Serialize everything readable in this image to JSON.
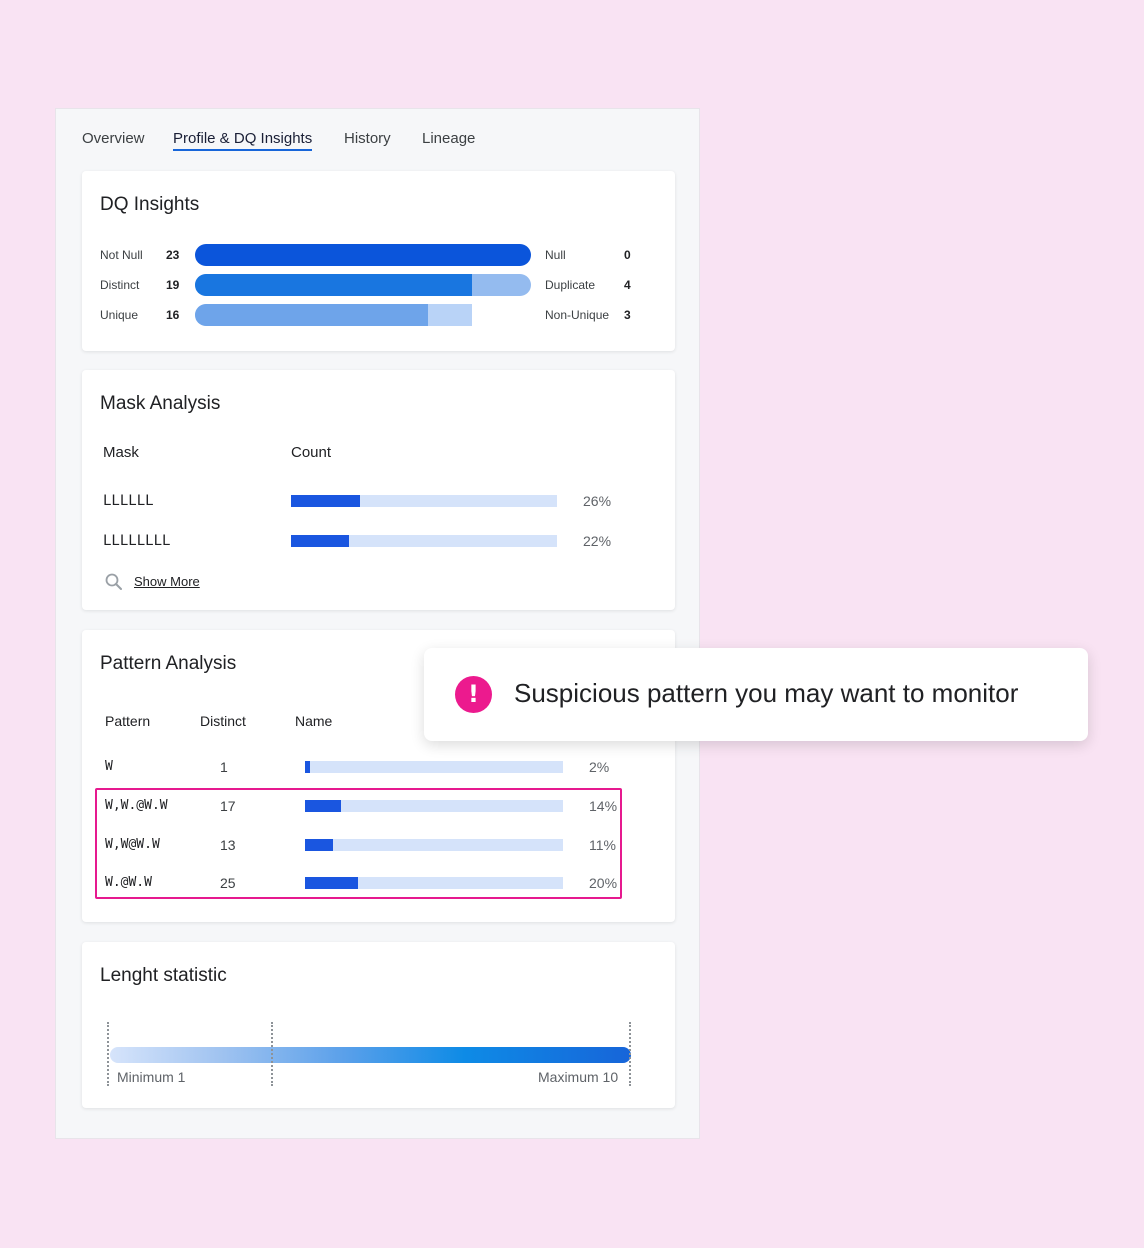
{
  "tabs": [
    {
      "label": "Overview"
    },
    {
      "label": "Profile & DQ Insights",
      "active": true
    },
    {
      "label": "History"
    },
    {
      "label": "Lineage"
    }
  ],
  "dq_insights": {
    "title": "DQ Insights",
    "rows": [
      {
        "label": "Not Null",
        "count": "23",
        "right_label": "Null",
        "right_count": "0"
      },
      {
        "label": "Distinct",
        "count": "19",
        "right_label": "Duplicate",
        "right_count": "4"
      },
      {
        "label": "Unique",
        "count": "16",
        "right_label": "Non-Unique",
        "right_count": "3"
      }
    ],
    "colors": {
      "primary": "#0b55db",
      "secondary": "#1976e0",
      "tertiary": "#6ea4ea"
    }
  },
  "mask_analysis": {
    "title": "Mask Analysis",
    "headers": {
      "mask": "Mask",
      "count": "Count"
    },
    "rows": [
      {
        "mask": "LLLLLL",
        "percent": "26%",
        "fraction": 0.26
      },
      {
        "mask": "LLLLLLLL",
        "percent": "22%",
        "fraction": 0.22
      }
    ],
    "show_more": "Show More",
    "search_icon": "search-icon"
  },
  "pattern_analysis": {
    "title": "Pattern Analysis",
    "headers": {
      "pattern": "Pattern",
      "distinct": "Distinct",
      "name": "Name"
    },
    "rows": [
      {
        "pattern": "W",
        "distinct": "1",
        "percent": "2%",
        "fraction": 0.02
      },
      {
        "pattern": "W,W.@W.W",
        "distinct": "17",
        "percent": "14%",
        "fraction": 0.14
      },
      {
        "pattern": "W,W@W.W",
        "distinct": "13",
        "percent": "11%",
        "fraction": 0.11
      },
      {
        "pattern": "W.@W.W",
        "distinct": "25",
        "percent": "20%",
        "fraction": 0.2
      }
    ],
    "highlight_color": "#e6198f"
  },
  "callout": {
    "icon": "exclamation-icon",
    "text": "Suspicious pattern you may want to monitor",
    "icon_color": "#ec1a8e"
  },
  "length_statistic": {
    "title": "Lenght statistic",
    "minimum_label": "Minimum 1",
    "maximum_label": "Maximum 10"
  }
}
